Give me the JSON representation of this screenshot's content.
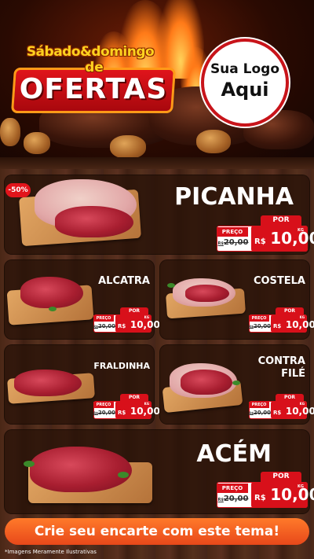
{
  "header": {
    "title_top": "Sábado&domingo",
    "title_de": "de",
    "title_main": "OFERTAS",
    "logo_line1": "Sua Logo",
    "logo_line2": "Aqui"
  },
  "discount_badge": "-50%",
  "price_labels": {
    "por": "POR",
    "preco": "PREÇO",
    "currency": "R$",
    "unit": "KG"
  },
  "products": [
    {
      "name": "PICANHA",
      "old_prefix": "R$",
      "old_price": "20,00",
      "price": "10,00"
    },
    {
      "name": "ALCATRA",
      "old_prefix": "R$",
      "old_price": "20,00",
      "price": "10,00"
    },
    {
      "name": "COSTELA",
      "old_prefix": "R$",
      "old_price": "20,00",
      "price": "10,00"
    },
    {
      "name": "FRALDINHA",
      "old_prefix": "R$",
      "old_price": "20,00",
      "price": "10,00"
    },
    {
      "name_line1": "CONTRA",
      "name_line2": "FILÉ",
      "old_prefix": "R$",
      "old_price": "20,00",
      "price": "10,00"
    },
    {
      "name": "ACÉM",
      "old_prefix": "R$",
      "old_price": "20,00",
      "price": "10,00"
    }
  ],
  "footer": {
    "cta": "Crie seu encarte com este tema!",
    "disclaimer": "*Imagens Meramente Ilustrativas"
  },
  "colors": {
    "accent_red": "#d8101a",
    "title_yellow": "#ffd21f",
    "cta_orange": "#e8481a",
    "wood": "#4a2716"
  }
}
